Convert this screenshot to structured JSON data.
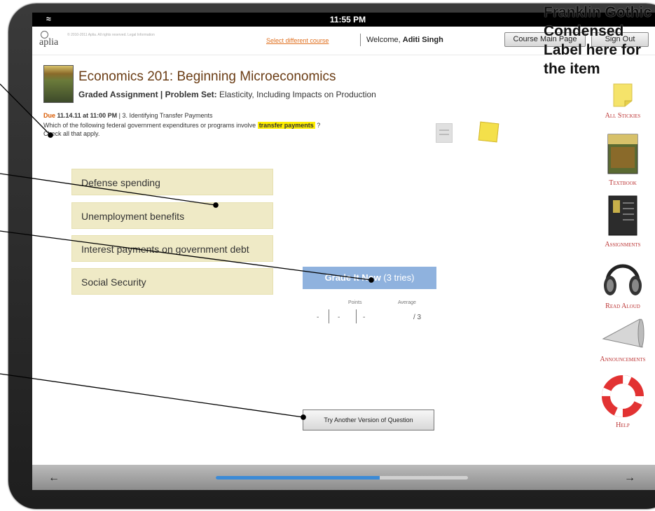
{
  "status": {
    "time": "11:55 PM"
  },
  "header": {
    "logo": "aplia",
    "copyright": "© 2010-2011 Aplia. All rights reserved. Legal Information",
    "select_course": "Select different course",
    "welcome_prefix": "Welcome,",
    "user_name": "Aditi Singh",
    "course_main_page": "Course Main Page",
    "sign_out": "Sign Out"
  },
  "course": {
    "title": "Economics 201: Beginning Microeconomics",
    "assignment_label": "Graded Assignment | Problem Set:",
    "assignment_name": "Elasticity, Including Impacts on Production"
  },
  "question": {
    "due_label": "Due",
    "due_date": "11.14.11 at 11:00 PM",
    "item": "| 3. Identifying Transfer Payments",
    "text_before": "Which of the following federal government expenditures or programs involve",
    "highlight": "transfer payments",
    "text_after": "?",
    "instruction": "Check all that apply.",
    "options": [
      "Defense spending",
      "Unemployment benefits",
      "Interest payments on government debt",
      "Social Security"
    ]
  },
  "grading": {
    "button_label": "Grade It Now",
    "tries": "(3 tries)",
    "points_label": "Points",
    "average_label": "Average",
    "values": [
      "-",
      "-",
      "-",
      "/ 3"
    ]
  },
  "try_another": "Try Another Version of Question",
  "sidebar": {
    "items": [
      {
        "label": "All Stickies",
        "icon": "sticky-note-icon"
      },
      {
        "label": "Textbook",
        "icon": "textbook-icon"
      },
      {
        "label": "Assignments",
        "icon": "assignments-icon"
      },
      {
        "label": "Read Aloud",
        "icon": "headphones-icon"
      },
      {
        "label": "Announcements",
        "icon": "megaphone-icon"
      },
      {
        "label": "Help",
        "icon": "lifebuoy-icon"
      }
    ]
  },
  "annotation": {
    "label_lines": [
      "Franklin Gothic",
      "Condensed",
      "Label here for",
      "the item"
    ]
  },
  "progress": {
    "fraction": 0.65
  },
  "colors": {
    "title": "#6a3c14",
    "due": "#d95a00",
    "highlight": "#ffee00",
    "option_bg": "#efeac6",
    "grade_button": "#8fb2de",
    "sidebar_label": "#b33333",
    "progress": "#3b8ad6"
  }
}
